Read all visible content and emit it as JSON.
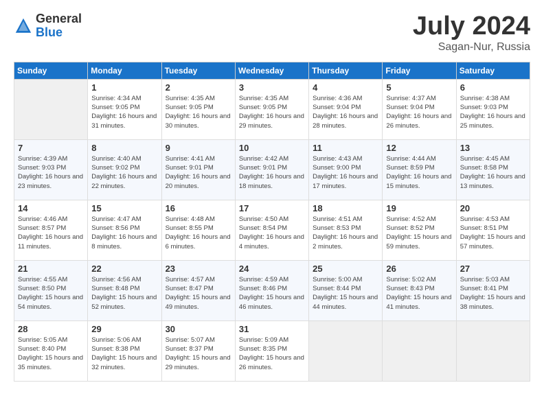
{
  "header": {
    "logo_line1": "General",
    "logo_line2": "Blue",
    "month": "July 2024",
    "location": "Sagan-Nur, Russia"
  },
  "weekdays": [
    "Sunday",
    "Monday",
    "Tuesday",
    "Wednesday",
    "Thursday",
    "Friday",
    "Saturday"
  ],
  "weeks": [
    [
      {
        "day": "",
        "sunrise": "",
        "sunset": "",
        "daylight": ""
      },
      {
        "day": "1",
        "sunrise": "Sunrise: 4:34 AM",
        "sunset": "Sunset: 9:05 PM",
        "daylight": "Daylight: 16 hours and 31 minutes."
      },
      {
        "day": "2",
        "sunrise": "Sunrise: 4:35 AM",
        "sunset": "Sunset: 9:05 PM",
        "daylight": "Daylight: 16 hours and 30 minutes."
      },
      {
        "day": "3",
        "sunrise": "Sunrise: 4:35 AM",
        "sunset": "Sunset: 9:05 PM",
        "daylight": "Daylight: 16 hours and 29 minutes."
      },
      {
        "day": "4",
        "sunrise": "Sunrise: 4:36 AM",
        "sunset": "Sunset: 9:04 PM",
        "daylight": "Daylight: 16 hours and 28 minutes."
      },
      {
        "day": "5",
        "sunrise": "Sunrise: 4:37 AM",
        "sunset": "Sunset: 9:04 PM",
        "daylight": "Daylight: 16 hours and 26 minutes."
      },
      {
        "day": "6",
        "sunrise": "Sunrise: 4:38 AM",
        "sunset": "Sunset: 9:03 PM",
        "daylight": "Daylight: 16 hours and 25 minutes."
      }
    ],
    [
      {
        "day": "7",
        "sunrise": "Sunrise: 4:39 AM",
        "sunset": "Sunset: 9:03 PM",
        "daylight": "Daylight: 16 hours and 23 minutes."
      },
      {
        "day": "8",
        "sunrise": "Sunrise: 4:40 AM",
        "sunset": "Sunset: 9:02 PM",
        "daylight": "Daylight: 16 hours and 22 minutes."
      },
      {
        "day": "9",
        "sunrise": "Sunrise: 4:41 AM",
        "sunset": "Sunset: 9:01 PM",
        "daylight": "Daylight: 16 hours and 20 minutes."
      },
      {
        "day": "10",
        "sunrise": "Sunrise: 4:42 AM",
        "sunset": "Sunset: 9:01 PM",
        "daylight": "Daylight: 16 hours and 18 minutes."
      },
      {
        "day": "11",
        "sunrise": "Sunrise: 4:43 AM",
        "sunset": "Sunset: 9:00 PM",
        "daylight": "Daylight: 16 hours and 17 minutes."
      },
      {
        "day": "12",
        "sunrise": "Sunrise: 4:44 AM",
        "sunset": "Sunset: 8:59 PM",
        "daylight": "Daylight: 16 hours and 15 minutes."
      },
      {
        "day": "13",
        "sunrise": "Sunrise: 4:45 AM",
        "sunset": "Sunset: 8:58 PM",
        "daylight": "Daylight: 16 hours and 13 minutes."
      }
    ],
    [
      {
        "day": "14",
        "sunrise": "Sunrise: 4:46 AM",
        "sunset": "Sunset: 8:57 PM",
        "daylight": "Daylight: 16 hours and 11 minutes."
      },
      {
        "day": "15",
        "sunrise": "Sunrise: 4:47 AM",
        "sunset": "Sunset: 8:56 PM",
        "daylight": "Daylight: 16 hours and 8 minutes."
      },
      {
        "day": "16",
        "sunrise": "Sunrise: 4:48 AM",
        "sunset": "Sunset: 8:55 PM",
        "daylight": "Daylight: 16 hours and 6 minutes."
      },
      {
        "day": "17",
        "sunrise": "Sunrise: 4:50 AM",
        "sunset": "Sunset: 8:54 PM",
        "daylight": "Daylight: 16 hours and 4 minutes."
      },
      {
        "day": "18",
        "sunrise": "Sunrise: 4:51 AM",
        "sunset": "Sunset: 8:53 PM",
        "daylight": "Daylight: 16 hours and 2 minutes."
      },
      {
        "day": "19",
        "sunrise": "Sunrise: 4:52 AM",
        "sunset": "Sunset: 8:52 PM",
        "daylight": "Daylight: 15 hours and 59 minutes."
      },
      {
        "day": "20",
        "sunrise": "Sunrise: 4:53 AM",
        "sunset": "Sunset: 8:51 PM",
        "daylight": "Daylight: 15 hours and 57 minutes."
      }
    ],
    [
      {
        "day": "21",
        "sunrise": "Sunrise: 4:55 AM",
        "sunset": "Sunset: 8:50 PM",
        "daylight": "Daylight: 15 hours and 54 minutes."
      },
      {
        "day": "22",
        "sunrise": "Sunrise: 4:56 AM",
        "sunset": "Sunset: 8:48 PM",
        "daylight": "Daylight: 15 hours and 52 minutes."
      },
      {
        "day": "23",
        "sunrise": "Sunrise: 4:57 AM",
        "sunset": "Sunset: 8:47 PM",
        "daylight": "Daylight: 15 hours and 49 minutes."
      },
      {
        "day": "24",
        "sunrise": "Sunrise: 4:59 AM",
        "sunset": "Sunset: 8:46 PM",
        "daylight": "Daylight: 15 hours and 46 minutes."
      },
      {
        "day": "25",
        "sunrise": "Sunrise: 5:00 AM",
        "sunset": "Sunset: 8:44 PM",
        "daylight": "Daylight: 15 hours and 44 minutes."
      },
      {
        "day": "26",
        "sunrise": "Sunrise: 5:02 AM",
        "sunset": "Sunset: 8:43 PM",
        "daylight": "Daylight: 15 hours and 41 minutes."
      },
      {
        "day": "27",
        "sunrise": "Sunrise: 5:03 AM",
        "sunset": "Sunset: 8:41 PM",
        "daylight": "Daylight: 15 hours and 38 minutes."
      }
    ],
    [
      {
        "day": "28",
        "sunrise": "Sunrise: 5:05 AM",
        "sunset": "Sunset: 8:40 PM",
        "daylight": "Daylight: 15 hours and 35 minutes."
      },
      {
        "day": "29",
        "sunrise": "Sunrise: 5:06 AM",
        "sunset": "Sunset: 8:38 PM",
        "daylight": "Daylight: 15 hours and 32 minutes."
      },
      {
        "day": "30",
        "sunrise": "Sunrise: 5:07 AM",
        "sunset": "Sunset: 8:37 PM",
        "daylight": "Daylight: 15 hours and 29 minutes."
      },
      {
        "day": "31",
        "sunrise": "Sunrise: 5:09 AM",
        "sunset": "Sunset: 8:35 PM",
        "daylight": "Daylight: 15 hours and 26 minutes."
      },
      {
        "day": "",
        "sunrise": "",
        "sunset": "",
        "daylight": ""
      },
      {
        "day": "",
        "sunrise": "",
        "sunset": "",
        "daylight": ""
      },
      {
        "day": "",
        "sunrise": "",
        "sunset": "",
        "daylight": ""
      }
    ]
  ]
}
